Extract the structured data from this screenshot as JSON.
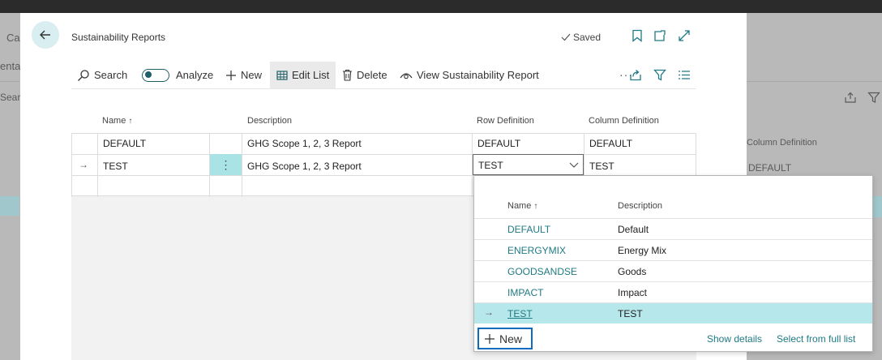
{
  "background": {
    "texts": [
      "Ca",
      "enta",
      "Searc"
    ],
    "right_column_header": "Column Definition",
    "right_default": "DEFAULT"
  },
  "modal": {
    "title": "Sustainability Reports",
    "saved": "Saved",
    "actions": {
      "search": "Search",
      "analyze": "Analyze",
      "new": "New",
      "edit_list": "Edit List",
      "delete": "Delete",
      "view_report": "View Sustainability Report",
      "more": "···"
    }
  },
  "grid": {
    "columns": {
      "name": "Name",
      "description": "Description",
      "row_definition": "Row Definition",
      "column_definition": "Column Definition"
    },
    "rows": [
      {
        "name": "DEFAULT",
        "description": "GHG Scope 1, 2, 3 Report",
        "row_definition": "DEFAULT",
        "column_definition": "DEFAULT"
      },
      {
        "name": "TEST",
        "description": "GHG Scope 1, 2, 3 Report",
        "row_definition": "TEST",
        "column_definition": "TEST"
      }
    ],
    "current_row_marker": "→",
    "row_menu": "⋮"
  },
  "lookup": {
    "columns": {
      "name": "Name",
      "description": "Description"
    },
    "rows": [
      {
        "name": "DEFAULT",
        "description": "Default"
      },
      {
        "name": "ENERGYMIX",
        "description": "Energy Mix"
      },
      {
        "name": "GOODSANDSE",
        "description": "Goods"
      },
      {
        "name": "IMPACT",
        "description": "Impact"
      },
      {
        "name": "TEST",
        "description": "TEST"
      }
    ],
    "selected_marker": "→",
    "new_label": "New",
    "show_details": "Show details",
    "select_full_list": "Select from full list"
  }
}
